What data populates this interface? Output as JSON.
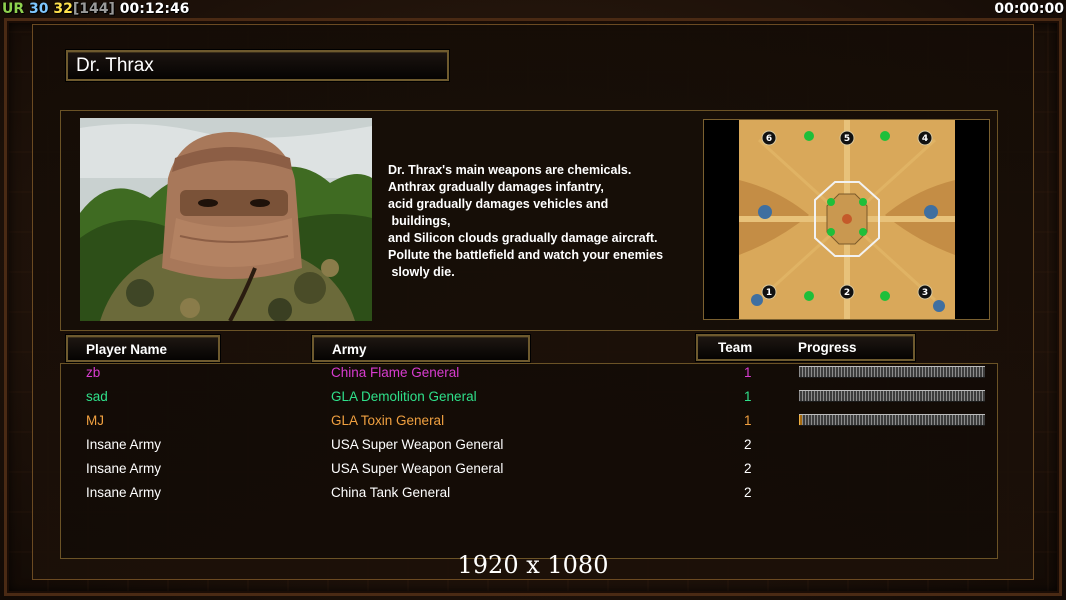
{
  "hud": {
    "prefix": "UR",
    "val1": "30",
    "val2": "32",
    "bracket": "[144]",
    "elapsed": "00:12:46",
    "right_timer": "00:00:00"
  },
  "general": {
    "name": "Dr. Thrax",
    "description": "Dr. Thrax's main weapons are chemicals.\nAnthrax gradually damages infantry,\nacid gradually damages vehicles and\n buildings,\nand Silicon clouds gradually damage aircraft.\nPollute the battlefield and watch your enemies\n slowly die."
  },
  "minimap": {
    "slots": [
      "6",
      "5",
      "4",
      "1",
      "2",
      "3"
    ]
  },
  "table": {
    "headers": {
      "player": "Player Name",
      "army": "Army",
      "team": "Team",
      "progress": "Progress"
    },
    "rows": [
      {
        "player": "zb",
        "army": "China Flame General",
        "team": "1",
        "color": "#d83cd0",
        "progress": 0,
        "show_progress": true
      },
      {
        "player": "sad",
        "army": "GLA Demolition General",
        "team": "1",
        "color": "#2fe08a",
        "progress": 0,
        "show_progress": true
      },
      {
        "player": "MJ",
        "army": "GLA Toxin General",
        "team": "1",
        "color": "#f0a040",
        "progress": 0.015,
        "show_progress": true
      },
      {
        "player": "Insane Army",
        "army": "USA Super Weapon General",
        "team": "2",
        "color": "#ffffff",
        "show_progress": false
      },
      {
        "player": "Insane Army",
        "army": "USA Super Weapon General",
        "team": "2",
        "color": "#ffffff",
        "show_progress": false
      },
      {
        "player": "Insane Army",
        "army": "China Tank General",
        "team": "2",
        "color": "#ffffff",
        "show_progress": false
      }
    ]
  },
  "footer": {
    "resolution": "1920 x 1080"
  }
}
